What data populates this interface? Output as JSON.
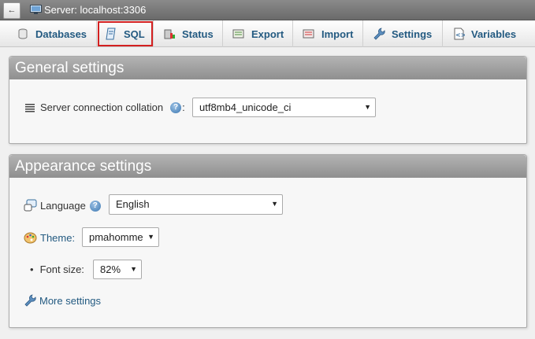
{
  "topbar": {
    "back_label": "←",
    "server_title": "Server: localhost:3306"
  },
  "tabs": [
    {
      "label": "Databases",
      "icon": "database-icon"
    },
    {
      "label": "SQL",
      "icon": "sql-icon",
      "active": true
    },
    {
      "label": "Status",
      "icon": "status-icon"
    },
    {
      "label": "Export",
      "icon": "export-icon"
    },
    {
      "label": "Import",
      "icon": "import-icon"
    },
    {
      "label": "Settings",
      "icon": "wrench-icon"
    },
    {
      "label": "Variables",
      "icon": "variables-icon"
    }
  ],
  "general": {
    "title": "General settings",
    "collation_label": "Server connection collation",
    "collation_suffix": ":",
    "collation_value": "utf8mb4_unicode_ci"
  },
  "appearance": {
    "title": "Appearance settings",
    "language_label": "Language",
    "language_value": "English",
    "theme_label": "Theme:",
    "theme_value": "pmahomme",
    "font_size_label": "Font size:",
    "font_size_value": "82%",
    "more_settings_label": "More settings"
  },
  "help_glyph": "?",
  "caret_glyph": "▼",
  "bullet_glyph": "•",
  "colors": {
    "link": "#235a81",
    "active_outline": "#d32020",
    "header_gradient_top": "#b3b3b3",
    "header_gradient_bottom": "#8f8f8f"
  }
}
